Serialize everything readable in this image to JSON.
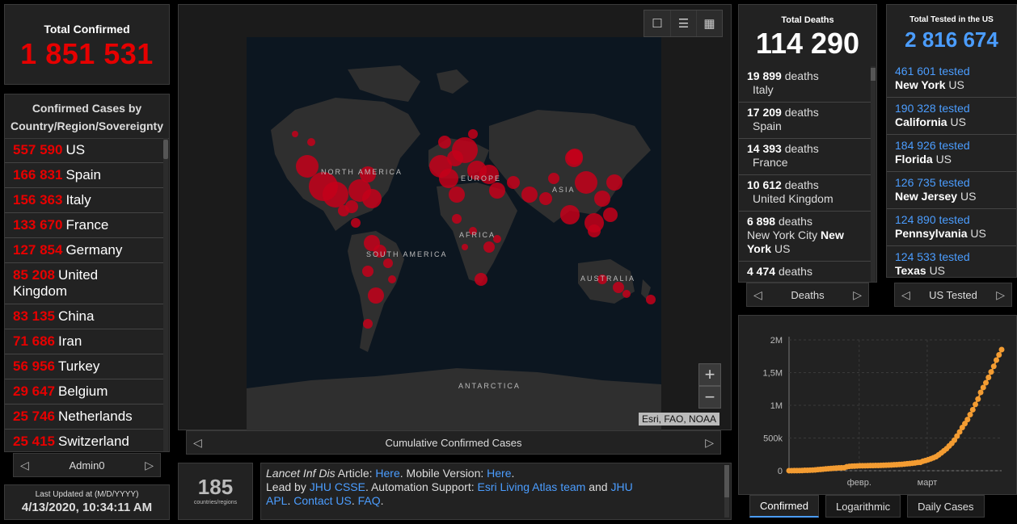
{
  "total": {
    "label": "Total Confirmed",
    "value": "1 851 531"
  },
  "countries": {
    "header": "Confirmed Cases by Country/Region/Sovereignty",
    "rows": [
      {
        "v": "557 590",
        "n": "US"
      },
      {
        "v": "166 831",
        "n": "Spain"
      },
      {
        "v": "156 363",
        "n": "Italy"
      },
      {
        "v": "133 670",
        "n": "France"
      },
      {
        "v": "127 854",
        "n": "Germany"
      },
      {
        "v": "85 208",
        "n": "United Kingdom"
      },
      {
        "v": "83 135",
        "n": "China"
      },
      {
        "v": "71 686",
        "n": "Iran"
      },
      {
        "v": "56 956",
        "n": "Turkey"
      },
      {
        "v": "29 647",
        "n": "Belgium"
      },
      {
        "v": "25 746",
        "n": "Netherlands"
      },
      {
        "v": "25 415",
        "n": "Switzerland"
      }
    ],
    "pager_label": "Admin0"
  },
  "updated": {
    "label": "Last Updated at (M/D/YYYY)",
    "value": "4/13/2020, 10:34:11 AM"
  },
  "map": {
    "labels": {
      "north_america": "NORTH AMERICA",
      "south_america": "SOUTH AMERICA",
      "europe": "EUROPE",
      "asia": "ASIA",
      "africa": "AFRICA",
      "australia": "AUSTRALIA",
      "antarctica": "ANTARCTICA"
    },
    "attribution": "Esri, FAO, NOAA",
    "pager_label": "Cumulative Confirmed Cases",
    "toolbar": [
      "bookmark-icon",
      "list-icon",
      "qr-icon"
    ],
    "marker_color": "#c4001a"
  },
  "count": {
    "value": "185",
    "label": "countries/regions"
  },
  "info": {
    "line1_pre": "Lancet Inf Dis",
    "line1_mid": " Article: ",
    "link_here1": "Here",
    "line1_mid2": ". Mobile Version: ",
    "link_here2": "Here",
    "line1_end": ".",
    "line2_pre": "Lead by ",
    "link_jhu": "JHU CSSE",
    "line2_mid": ". Automation Support: ",
    "link_esri": "Esri Living Atlas team",
    "line2_and": " and ",
    "link_jhu2": "JHU",
    "link_apl": "APL",
    "sep": ". ",
    "link_contact": "Contact US",
    "link_faq": "FAQ",
    "dot": "."
  },
  "deaths": {
    "label": "Total Deaths",
    "value": "114 290",
    "word": "deaths",
    "rows": [
      {
        "v": "19 899",
        "loc": "Italy",
        "bold": ""
      },
      {
        "v": "17 209",
        "loc": "Spain",
        "bold": ""
      },
      {
        "v": "14 393",
        "loc": "France",
        "bold": ""
      },
      {
        "v": "10 612",
        "loc": "United Kingdom",
        "bold": ""
      },
      {
        "v": "6 898",
        "loc": "New York City ",
        "bold": "New York",
        "tail": " US"
      },
      {
        "v": "4 474",
        "loc": "",
        "bold": ""
      }
    ],
    "pager_label": "Deaths"
  },
  "tested": {
    "label": "Total Tested in the US",
    "value": "2 816 674",
    "word": "tested",
    "rows": [
      {
        "v": "461 601",
        "st": "New York",
        "c": "US"
      },
      {
        "v": "190 328",
        "st": "California",
        "c": "US"
      },
      {
        "v": "184 926",
        "st": "Florida",
        "c": "US"
      },
      {
        "v": "126 735",
        "st": "New Jersey",
        "c": "US"
      },
      {
        "v": "124 890",
        "st": "Pennsylvania",
        "c": "US"
      },
      {
        "v": "124 533",
        "st": "Texas",
        "c": "US"
      }
    ],
    "pager_label": "US Tested"
  },
  "tabs": [
    "Confirmed",
    "Logarithmic",
    "Daily Cases"
  ],
  "chart_data": {
    "type": "line",
    "ylim": [
      0,
      2000000
    ],
    "yticks": [
      "0",
      "500k",
      "1M",
      "1,5M",
      "2M"
    ],
    "xticks": [
      "февр.",
      "март"
    ],
    "color": "#f39c32",
    "values": [
      555,
      654,
      941,
      1434,
      2118,
      2927,
      5578,
      6166,
      8234,
      9927,
      12038,
      16787,
      19881,
      23892,
      27635,
      30794,
      34391,
      37120,
      40150,
      42762,
      44802,
      45221,
      60368,
      66885,
      69030,
      71224,
      73258,
      75136,
      75639,
      76197,
      76819,
      78572,
      78958,
      79561,
      80406,
      81388,
      82746,
      84112,
      86011,
      88369,
      90306,
      92840,
      95120,
      97886,
      101801,
      105847,
      109821,
      113590,
      118620,
      125875,
      128343,
      145193,
      156097,
      167449,
      181546,
      197168,
      214915,
      242713,
      272167,
      304528,
      335955,
      378287,
      417966,
      467594,
      529591,
      593291,
      660706,
      720117,
      782365,
      857487,
      932605,
      1013157,
      1095917,
      1197405,
      1272115,
      1345101,
      1426096,
      1511104,
      1595350,
      1691719,
      1771514,
      1851531
    ]
  }
}
